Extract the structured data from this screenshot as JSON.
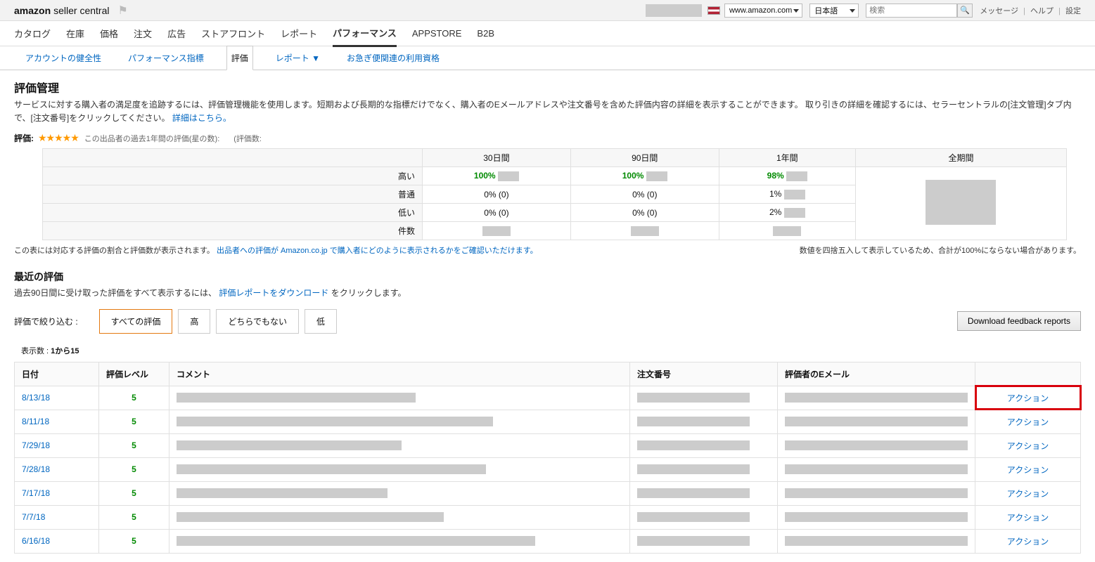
{
  "header": {
    "logo_amazon": "amazon",
    "logo_seller": "seller central",
    "market_select": "www.amazon.com",
    "lang_select": "日本語",
    "search_placeholder": "検索",
    "links": {
      "messages": "メッセージ",
      "help": "ヘルプ",
      "settings": "設定"
    }
  },
  "mainnav": [
    "カタログ",
    "在庫",
    "価格",
    "注文",
    "広告",
    "ストアフロント",
    "レポート",
    "パフォーマンス",
    "APPSTORE",
    "B2B"
  ],
  "mainnav_active": 7,
  "subnav": {
    "tabs": [
      "アカウントの健全性",
      "パフォーマンス指標",
      "評価",
      "レポート ▼",
      "お急ぎ便関連の利用資格"
    ],
    "active": 2
  },
  "page": {
    "title": "評価管理",
    "descr": "サービスに対する購入者の満足度を追跡するには、評価管理機能を使用します。短期および長期的な指標だけでなく、購入者のEメールアドレスや注文番号を含めた評価内容の詳細を表示することができます。 取り引きの詳細を確認するには、セラーセントラルの[注文管理]タブ内で、[注文番号]をクリックしてください。",
    "descr_link": "詳細はこちら。"
  },
  "rating": {
    "label": "評価:",
    "stars_text": "★★★★★",
    "subtitle1": "この出品者の過去1年間の評価(星の数):",
    "subtitle2": "(評価数:"
  },
  "summary": {
    "cols": [
      "30日間",
      "90日間",
      "1年間",
      "全期間"
    ],
    "rows": [
      {
        "label": "高い",
        "vals": [
          "100%",
          "100%",
          "98%",
          ""
        ]
      },
      {
        "label": "普通",
        "vals": [
          "0% (0)",
          "0% (0)",
          "1%",
          ""
        ]
      },
      {
        "label": "低い",
        "vals": [
          "0% (0)",
          "0% (0)",
          "2%",
          ""
        ]
      },
      {
        "label": "件数",
        "vals": [
          "",
          "",
          "",
          ""
        ]
      }
    ]
  },
  "footnote": {
    "left_a": "この表には対応する評価の割合と評価数が表示されます。",
    "left_link1": "出品者への評価が",
    "left_link2": " Amazon.co.jp で購入者にどのように表示されるかをご確認いただけます。",
    "right": "数値を四捨五入して表示しているため、合計が100%にならない場合があります。"
  },
  "recent": {
    "title": "最近の評価",
    "descr_a": "過去90日間に受け取った評価をすべて表示するには、",
    "descr_link": "評価レポートをダウンロード",
    "descr_b": "をクリックします。"
  },
  "filter": {
    "label": "評価で絞り込む :",
    "buttons": [
      "すべての評価",
      "高",
      "どちらでもない",
      "低"
    ],
    "active": 0,
    "download": "Download feedback reports"
  },
  "count_label_a": "表示数 :  ",
  "count_label_b": "1から15",
  "table": {
    "headers": [
      "日付",
      "評価レベル",
      "コメント",
      "注文番号",
      "評価者のEメール",
      ""
    ],
    "action_label": "アクション",
    "rows": [
      {
        "date": "8/13/18",
        "level": "5",
        "cw": 340,
        "highlight": true
      },
      {
        "date": "8/11/18",
        "level": "5",
        "cw": 450
      },
      {
        "date": "7/29/18",
        "level": "5",
        "cw": 320
      },
      {
        "date": "7/28/18",
        "level": "5",
        "cw": 440
      },
      {
        "date": "7/17/18",
        "level": "5",
        "cw": 300
      },
      {
        "date": "7/7/18",
        "level": "5",
        "cw": 380
      },
      {
        "date": "6/16/18",
        "level": "5",
        "cw": 510
      }
    ]
  }
}
